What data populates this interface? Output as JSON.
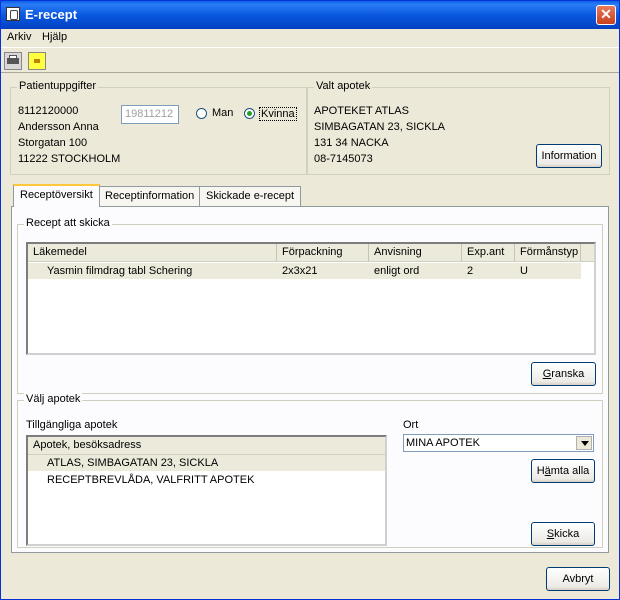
{
  "window": {
    "title": "E-recept",
    "close_glyph": "✕"
  },
  "menu": [
    "Arkiv",
    "Hjälp"
  ],
  "toolbar": {
    "icons": [
      "printer-icon",
      "new-document-icon"
    ]
  },
  "patient": {
    "legend": "Patientuppgifter",
    "id": "8112120000",
    "name": "Andersson Anna",
    "street": "Storgatan 100",
    "postal": "11222 STOCKHOLM",
    "birthdate": "19811212",
    "gender_options": [
      "Man",
      "Kvinna"
    ],
    "gender_selected": "Kvinna"
  },
  "pharmacy": {
    "legend": "Valt apotek",
    "name": "APOTEKET ATLAS",
    "street": "SIMBAGATAN 23, SICKLA",
    "postal": "131 34 NACKA",
    "phone": "08-7145073",
    "info_button": "Information"
  },
  "tabs": [
    "Receptöversikt",
    "Receptinformation",
    "Skickade e-recept"
  ],
  "active_tab": "Receptöversikt",
  "recipes": {
    "legend": "Recept att skicka",
    "columns": [
      "Läkemedel",
      "Förpackning",
      "Anvisning",
      "Exp.ant",
      "Förmånstyp"
    ],
    "rows": [
      {
        "drug": "Yasmin filmdrag tabl Schering",
        "pack": "2x3x21",
        "instr": "enligt ord",
        "exp": "2",
        "benefit": "U"
      }
    ],
    "review_button": "Granska"
  },
  "choose_pharmacy": {
    "legend": "Välj apotek",
    "available_label": "Tillgängliga apotek",
    "column": "Apotek, besöksadress",
    "items": [
      "ATLAS, SIMBAGATAN 23, SICKLA",
      "RECEPTBREVLÅDA, VALFRITT APOTEK"
    ],
    "city_label": "Ort",
    "city_value": "MINA APOTEK",
    "fetch_button": "Hämta alla",
    "send_button": "Skicka"
  },
  "cancel_button": "Avbryt"
}
